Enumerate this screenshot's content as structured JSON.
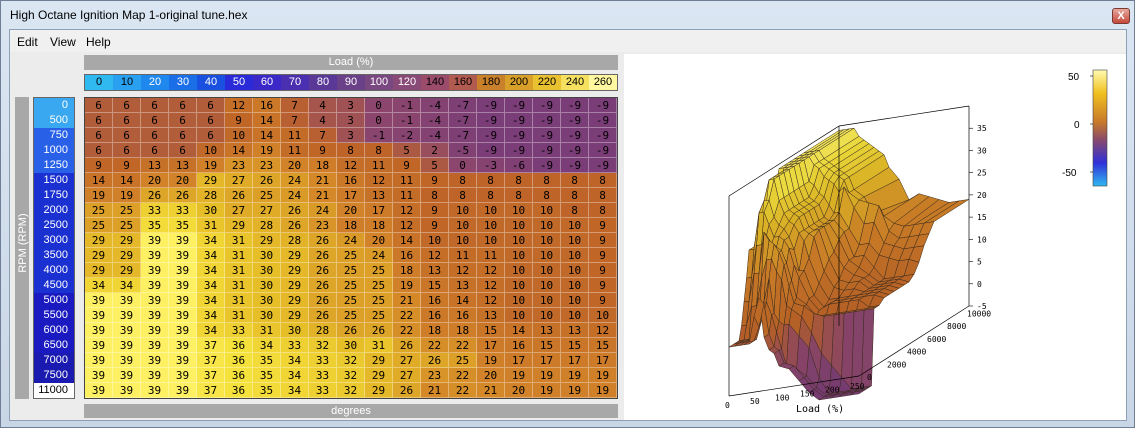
{
  "window": {
    "title": "High Octane Ignition Map 1-original tune.hex",
    "close_glyph": "X"
  },
  "menu": [
    "Edit",
    "View",
    "Help"
  ],
  "table": {
    "load_header": "Load (%)",
    "rpm_header": "RPM (RPM)",
    "units_footer": "degrees",
    "load_values": [
      "0",
      "10",
      "20",
      "30",
      "40",
      "50",
      "60",
      "70",
      "80",
      "90",
      "100",
      "120",
      "140",
      "160",
      "180",
      "200",
      "220",
      "240",
      "260"
    ],
    "rpm_values": [
      "0",
      "500",
      "750",
      "1000",
      "1250",
      "1500",
      "1750",
      "2000",
      "2500",
      "3000",
      "3500",
      "4000",
      "4500",
      "5000",
      "5500",
      "6000",
      "6500",
      "7000",
      "7500",
      "11000"
    ],
    "rows": [
      [
        "6",
        "6",
        "6",
        "6",
        "6",
        "12",
        "16",
        "7",
        "4",
        "3",
        "0",
        "-1",
        "-4",
        "-7",
        "-9",
        "-9",
        "-9",
        "-9",
        "-9"
      ],
      [
        "6",
        "6",
        "6",
        "6",
        "6",
        "9",
        "14",
        "7",
        "4",
        "3",
        "0",
        "-1",
        "-4",
        "-7",
        "-9",
        "-9",
        "-9",
        "-9",
        "-9"
      ],
      [
        "6",
        "6",
        "6",
        "6",
        "6",
        "10",
        "14",
        "11",
        "7",
        "3",
        "-1",
        "-2",
        "-4",
        "-7",
        "-9",
        "-9",
        "-9",
        "-9",
        "-9"
      ],
      [
        "6",
        "6",
        "6",
        "6",
        "10",
        "14",
        "19",
        "11",
        "9",
        "8",
        "8",
        "5",
        "2",
        "-5",
        "-9",
        "-9",
        "-9",
        "-9",
        "-9"
      ],
      [
        "9",
        "9",
        "13",
        "13",
        "19",
        "23",
        "23",
        "20",
        "18",
        "12",
        "11",
        "9",
        "5",
        "0",
        "-3",
        "-6",
        "-9",
        "-9",
        "-9"
      ],
      [
        "14",
        "14",
        "20",
        "20",
        "29",
        "27",
        "26",
        "24",
        "21",
        "16",
        "12",
        "11",
        "9",
        "8",
        "8",
        "8",
        "8",
        "8",
        "8"
      ],
      [
        "19",
        "19",
        "26",
        "26",
        "28",
        "26",
        "25",
        "24",
        "21",
        "17",
        "13",
        "11",
        "8",
        "8",
        "8",
        "8",
        "8",
        "8",
        "8"
      ],
      [
        "25",
        "25",
        "33",
        "33",
        "30",
        "27",
        "27",
        "26",
        "24",
        "20",
        "17",
        "12",
        "9",
        "10",
        "10",
        "10",
        "10",
        "8",
        "8"
      ],
      [
        "25",
        "25",
        "35",
        "35",
        "31",
        "29",
        "28",
        "26",
        "23",
        "18",
        "18",
        "12",
        "9",
        "10",
        "10",
        "10",
        "10",
        "10",
        "9"
      ],
      [
        "29",
        "29",
        "39",
        "39",
        "34",
        "31",
        "29",
        "28",
        "26",
        "24",
        "20",
        "14",
        "10",
        "10",
        "10",
        "10",
        "10",
        "10",
        "9"
      ],
      [
        "29",
        "29",
        "39",
        "39",
        "34",
        "31",
        "30",
        "29",
        "26",
        "25",
        "24",
        "16",
        "12",
        "11",
        "11",
        "10",
        "10",
        "10",
        "9"
      ],
      [
        "29",
        "29",
        "39",
        "39",
        "34",
        "31",
        "30",
        "29",
        "26",
        "25",
        "25",
        "18",
        "13",
        "12",
        "12",
        "10",
        "10",
        "10",
        "9"
      ],
      [
        "34",
        "34",
        "39",
        "39",
        "34",
        "31",
        "30",
        "29",
        "26",
        "25",
        "25",
        "19",
        "15",
        "13",
        "12",
        "10",
        "10",
        "10",
        "9"
      ],
      [
        "39",
        "39",
        "39",
        "39",
        "34",
        "31",
        "30",
        "29",
        "26",
        "25",
        "25",
        "21",
        "16",
        "14",
        "12",
        "10",
        "10",
        "10",
        "9"
      ],
      [
        "39",
        "39",
        "39",
        "39",
        "34",
        "31",
        "30",
        "29",
        "26",
        "25",
        "25",
        "22",
        "16",
        "16",
        "13",
        "10",
        "10",
        "10",
        "10"
      ],
      [
        "39",
        "39",
        "39",
        "39",
        "34",
        "33",
        "31",
        "30",
        "28",
        "26",
        "26",
        "22",
        "18",
        "18",
        "15",
        "14",
        "13",
        "13",
        "12"
      ],
      [
        "39",
        "39",
        "39",
        "39",
        "37",
        "36",
        "34",
        "33",
        "32",
        "30",
        "31",
        "26",
        "22",
        "22",
        "17",
        "16",
        "15",
        "15",
        "15"
      ],
      [
        "39",
        "39",
        "39",
        "39",
        "37",
        "36",
        "35",
        "34",
        "33",
        "32",
        "29",
        "27",
        "26",
        "25",
        "19",
        "17",
        "17",
        "17",
        "17"
      ],
      [
        "39",
        "39",
        "39",
        "39",
        "37",
        "36",
        "35",
        "34",
        "33",
        "32",
        "29",
        "27",
        "23",
        "22",
        "20",
        "19",
        "19",
        "19",
        "19"
      ],
      [
        "39",
        "39",
        "39",
        "39",
        "37",
        "36",
        "35",
        "34",
        "33",
        "32",
        "29",
        "26",
        "21",
        "22",
        "21",
        "20",
        "19",
        "19",
        "19"
      ]
    ]
  },
  "plot": {
    "x_title": "Load (%)",
    "x_ticks": [
      "0",
      "50",
      "100",
      "150",
      "200",
      "250"
    ],
    "y_ticks": [
      "0",
      "2000",
      "4000",
      "6000",
      "8000",
      "10000"
    ],
    "z_ticks": [
      "-5",
      "0",
      "5",
      "10",
      "15",
      "20",
      "25",
      "30",
      "35"
    ],
    "colorbar_ticks": [
      "50",
      "0",
      "-50"
    ]
  }
}
